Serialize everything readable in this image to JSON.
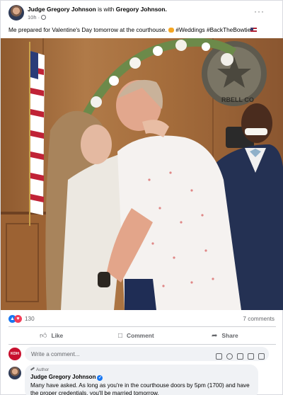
{
  "post": {
    "author": "Judge Gregory Johnson",
    "with_text": "is with",
    "tagged": "Gregory Johnson.",
    "time": "10h",
    "more_label": "···",
    "caption": "Me prepared for Valentine's Day tomorrow at the courthouse.",
    "hashtags": "#Weddings #BackTheBowtie"
  },
  "stats": {
    "reaction_count": "130",
    "comments": "7 comments"
  },
  "actions": {
    "like": "Like",
    "comment": "Comment",
    "share": "Share"
  },
  "composer": {
    "placeholder": "Write a comment...",
    "avatar_label": "KDH"
  },
  "reply": {
    "badge": "Author",
    "name": "Judge Gregory Johnson",
    "text": "Many have asked. As long as you're in the courthouse doors by 5pm (1700) and have the proper credentials, you'll be married tomorrow."
  },
  "photo": {
    "seal_text": "RBELL CO"
  },
  "colors": {
    "accent": "#1877f2",
    "love": "#f33e58",
    "muted": "#65676b"
  }
}
